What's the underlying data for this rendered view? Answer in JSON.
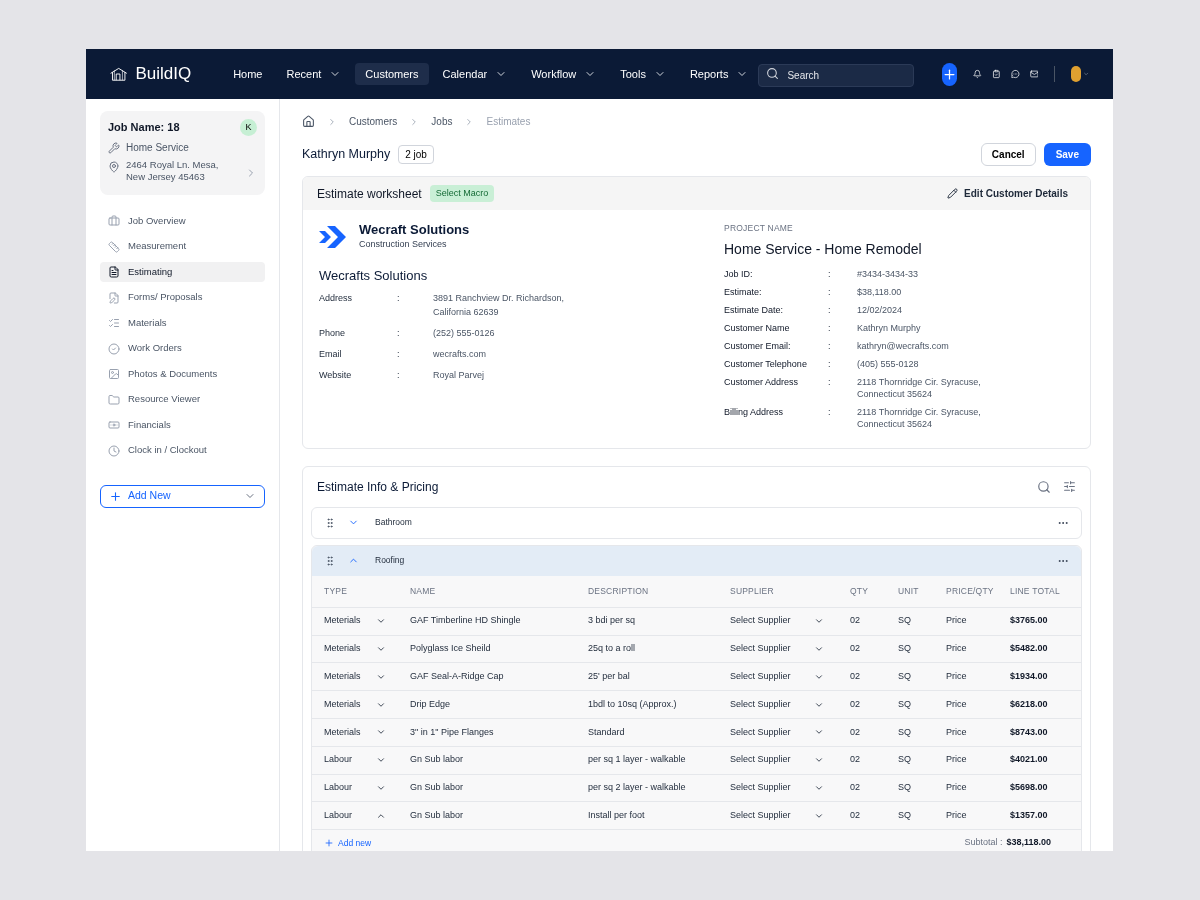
{
  "brand": "BuildIQ",
  "nav": [
    {
      "label": "Home",
      "dropdown": false,
      "selected": false
    },
    {
      "label": "Recent",
      "dropdown": true,
      "selected": false
    },
    {
      "label": "Customers",
      "dropdown": false,
      "selected": true
    },
    {
      "label": "Calendar",
      "dropdown": true,
      "selected": false
    },
    {
      "label": "Workflow",
      "dropdown": true,
      "selected": false
    },
    {
      "label": "Tools",
      "dropdown": true,
      "selected": false
    },
    {
      "label": "Reports",
      "dropdown": true,
      "selected": false
    }
  ],
  "search": {
    "placeholder": "Search"
  },
  "job_card": {
    "title": "Job Name: 18",
    "avatar": "K",
    "service": "Home Service",
    "address": "2464 Royal Ln. Mesa, New Jersey 45463"
  },
  "sidebar": {
    "items": [
      {
        "label": "Job Overview",
        "selected": false
      },
      {
        "label": "Measurement",
        "selected": false
      },
      {
        "label": "Estimating",
        "selected": true
      },
      {
        "label": "Forms/ Proposals",
        "selected": false
      },
      {
        "label": "Materials",
        "selected": false
      },
      {
        "label": "Work Orders",
        "selected": false
      },
      {
        "label": "Photos & Documents",
        "selected": false
      },
      {
        "label": "Resource Viewer",
        "selected": false
      },
      {
        "label": "Financials",
        "selected": false
      },
      {
        "label": "Clock in / Clockout",
        "selected": false
      }
    ],
    "add_button": "Add New"
  },
  "breadcrumb": [
    "Customers",
    "Jobs",
    "Estimates"
  ],
  "customer": {
    "name": "Kathryn Murphy",
    "badge": "2 job"
  },
  "actions": {
    "cancel": "Cancel",
    "save": "Save"
  },
  "worksheet": {
    "title": "Estimate worksheet",
    "macro": "Select Macro",
    "edit": "Edit Customer Details",
    "company": {
      "name": "Wecraft Solutions",
      "tagline": "Construction Services",
      "heading": "Wecrafts Solutions",
      "fields": [
        {
          "label": "Address",
          "separator": ":",
          "value": "3891 Ranchview Dr. Richardson, California 62639"
        },
        {
          "label": "Phone",
          "separator": ":",
          "value": "(252) 555-0126"
        },
        {
          "label": "Email",
          "separator": ":",
          "value": "wecrafts.com"
        },
        {
          "label": "Website",
          "separator": ":",
          "value": "Royal Parvej"
        }
      ]
    },
    "project": {
      "caption": "PROJECT NAME",
      "name": "Home Service - Home Remodel",
      "fields": [
        {
          "label": "Job ID:",
          "separator": ":",
          "value": "#3434-3434-33"
        },
        {
          "label": "Estimate:",
          "separator": ":",
          "value": "$38,118.00"
        },
        {
          "label": "Estimate Date:",
          "separator": ":",
          "value": "12/02/2024"
        },
        {
          "label": "Customer Name",
          "separator": ":",
          "value": "Kathryn Murphy"
        },
        {
          "label": "Customer Email:",
          "separator": ":",
          "value": "kathryn@wecrafts.com"
        },
        {
          "label": "Customer Telephone",
          "separator": ":",
          "value": "(405) 555-0128"
        },
        {
          "label": "Customer Address",
          "separator": ":",
          "value": "2118 Thornridge Cir. Syracuse, Connecticut 35624"
        },
        {
          "label": "Billing Address",
          "separator": ":",
          "value": "2118 Thornridge Cir. Syracuse, Connecticut 35624"
        }
      ]
    }
  },
  "pricing": {
    "title": "Estimate Info & Pricing",
    "sections": [
      {
        "name": "Bathroom",
        "expanded": false
      },
      {
        "name": "Roofing",
        "expanded": true
      }
    ],
    "columns": [
      "TYPE",
      "NAME",
      "DESCRIPTION",
      "SUPPLIER",
      "QTY",
      "UNIT",
      "PRICE/QTY",
      "LINE TOTAL"
    ],
    "rows": [
      {
        "type": "Meterials",
        "type_open": false,
        "name": "GAF Timberline HD Shingle",
        "description": "3 bdi per sq",
        "supplier": "Select Supplier",
        "qty": "02",
        "unit": "SQ",
        "price": "Price",
        "total": "$3765.00"
      },
      {
        "type": "Meterials",
        "type_open": false,
        "name": "Polyglass Ice Sheild",
        "description": "25q to a roll",
        "supplier": "Select Supplier",
        "qty": "02",
        "unit": "SQ",
        "price": "Price",
        "total": "$5482.00"
      },
      {
        "type": "Meterials",
        "type_open": false,
        "name": "GAF Seal-A-Ridge Cap",
        "description": "25' per bal",
        "supplier": "Select Supplier",
        "qty": "02",
        "unit": "SQ",
        "price": "Price",
        "total": "$1934.00"
      },
      {
        "type": "Meterials",
        "type_open": false,
        "name": "Drip Edge",
        "description": "1bdl to 10sq (Approx.)",
        "supplier": "Select Supplier",
        "qty": "02",
        "unit": "SQ",
        "price": "Price",
        "total": "$6218.00"
      },
      {
        "type": "Meterials",
        "type_open": false,
        "name": "3\" in 1\" Pipe Flanges",
        "description": "Standard",
        "supplier": "Select Supplier",
        "qty": "02",
        "unit": "SQ",
        "price": "Price",
        "total": "$8743.00"
      },
      {
        "type": "Labour",
        "type_open": false,
        "name": "Gn Sub labor",
        "description": "per sq 1 layer - walkable",
        "supplier": "Select Supplier",
        "qty": "02",
        "unit": "SQ",
        "price": "Price",
        "total": "$4021.00"
      },
      {
        "type": "Labour",
        "type_open": false,
        "name": "Gn Sub labor",
        "description": "per sq 2 layer - walkable",
        "supplier": "Select Supplier",
        "qty": "02",
        "unit": "SQ",
        "price": "Price",
        "total": "$5698.00"
      },
      {
        "type": "Labour",
        "type_open": true,
        "name": "Gn Sub labor",
        "description": "Install per foot",
        "supplier": "Select Supplier",
        "qty": "02",
        "unit": "SQ",
        "price": "Price",
        "total": "$1357.00"
      }
    ],
    "add_new": "Add new",
    "subtotal_label": "Subtotal :",
    "subtotal": "$38,118.00"
  }
}
